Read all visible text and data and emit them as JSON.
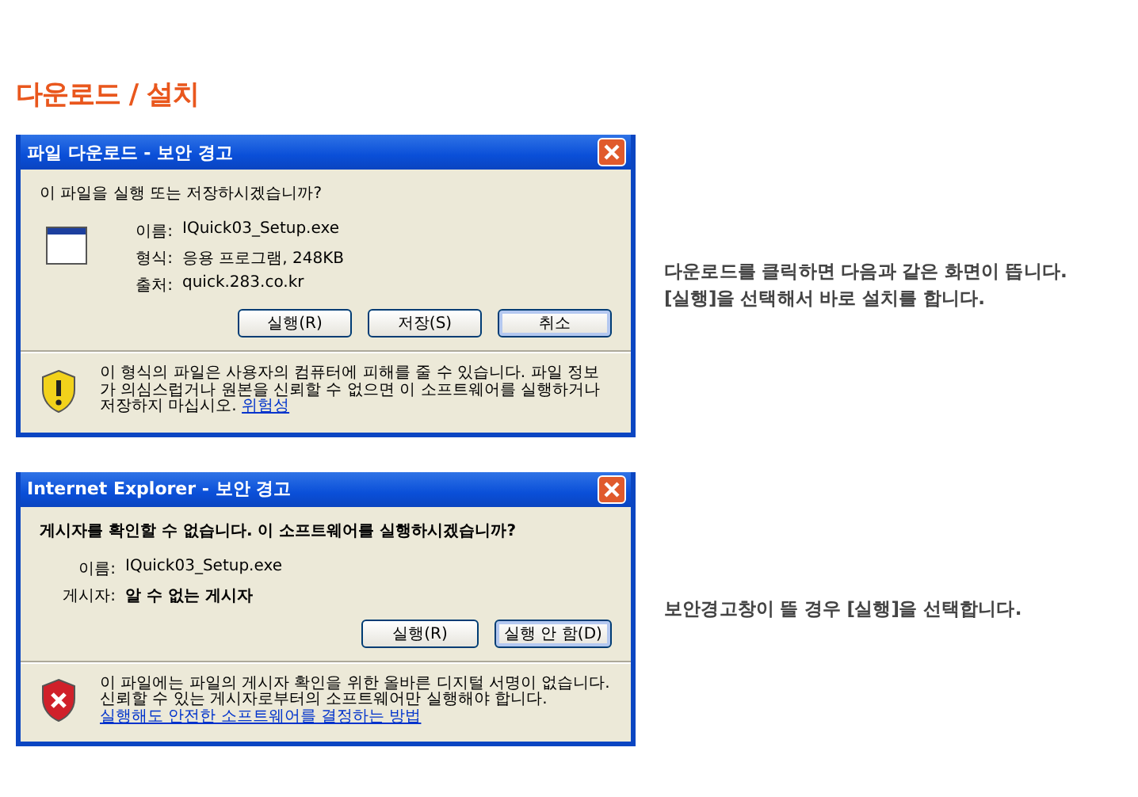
{
  "heading": "다운로드 / 설치",
  "sections": [
    {
      "dialog": {
        "kind": "download",
        "title": "파일 다운로드 - 보안 경고",
        "question": "이 파일을 실행 또는 저장하시겠습니까?",
        "question_bold": false,
        "fields": [
          {
            "label": "이름:",
            "value": "IQuick03_Setup.exe",
            "bold": false
          },
          {
            "label": "형식:",
            "value": "응용 프로그램, 248KB",
            "bold": false
          },
          {
            "label": "출처:",
            "value": "quick.283.co.kr",
            "bold": false
          }
        ],
        "buttons": [
          {
            "label": "실행(R)",
            "focused": false
          },
          {
            "label": "저장(S)",
            "focused": false
          },
          {
            "label": "취소",
            "focused": true
          }
        ],
        "notice": {
          "kind": "warning",
          "text": "이 형식의 파일은 사용자의 컴퓨터에 피해를 줄 수 있습니다. 파일 정보가 의심스럽거나 원본을 신뢰할 수 없으면 이 소프트웨어를 실행하거나 저장하지 마십시오.",
          "link": "위험성"
        }
      },
      "notes": [
        "다운로드를 클릭하면 다음과 같은 화면이 뜹니다.",
        "[실행]을 선택해서 바로 설치를 합니다."
      ]
    },
    {
      "dialog": {
        "kind": "ie",
        "title": "Internet Explorer - 보안 경고",
        "question": "게시자를 확인할 수 없습니다.  이 소프트웨어를 실행하시겠습니까?",
        "question_bold": true,
        "fields": [
          {
            "label": "이름:",
            "value": "IQuick03_Setup.exe",
            "bold": false
          },
          {
            "label": "게시자:",
            "value": "알 수 없는 게시자",
            "bold": true
          }
        ],
        "buttons": [
          {
            "label": "실행(R)",
            "focused": false
          },
          {
            "label": "실행 안 함(D)",
            "focused": true
          }
        ],
        "notice": {
          "kind": "error",
          "text": "이 파일에는 파일의 게시자 확인을 위한 올바른 디지털 서명이 없습니다. 신뢰할 수 있는 게시자로부터의 소프트웨어만 실행해야 합니다.",
          "link": "실행해도 안전한 소프트웨어를 결정하는 방법"
        }
      },
      "notes": [
        "보안경고창이 뜰 경우 [실행]을 선택합니다."
      ]
    }
  ]
}
